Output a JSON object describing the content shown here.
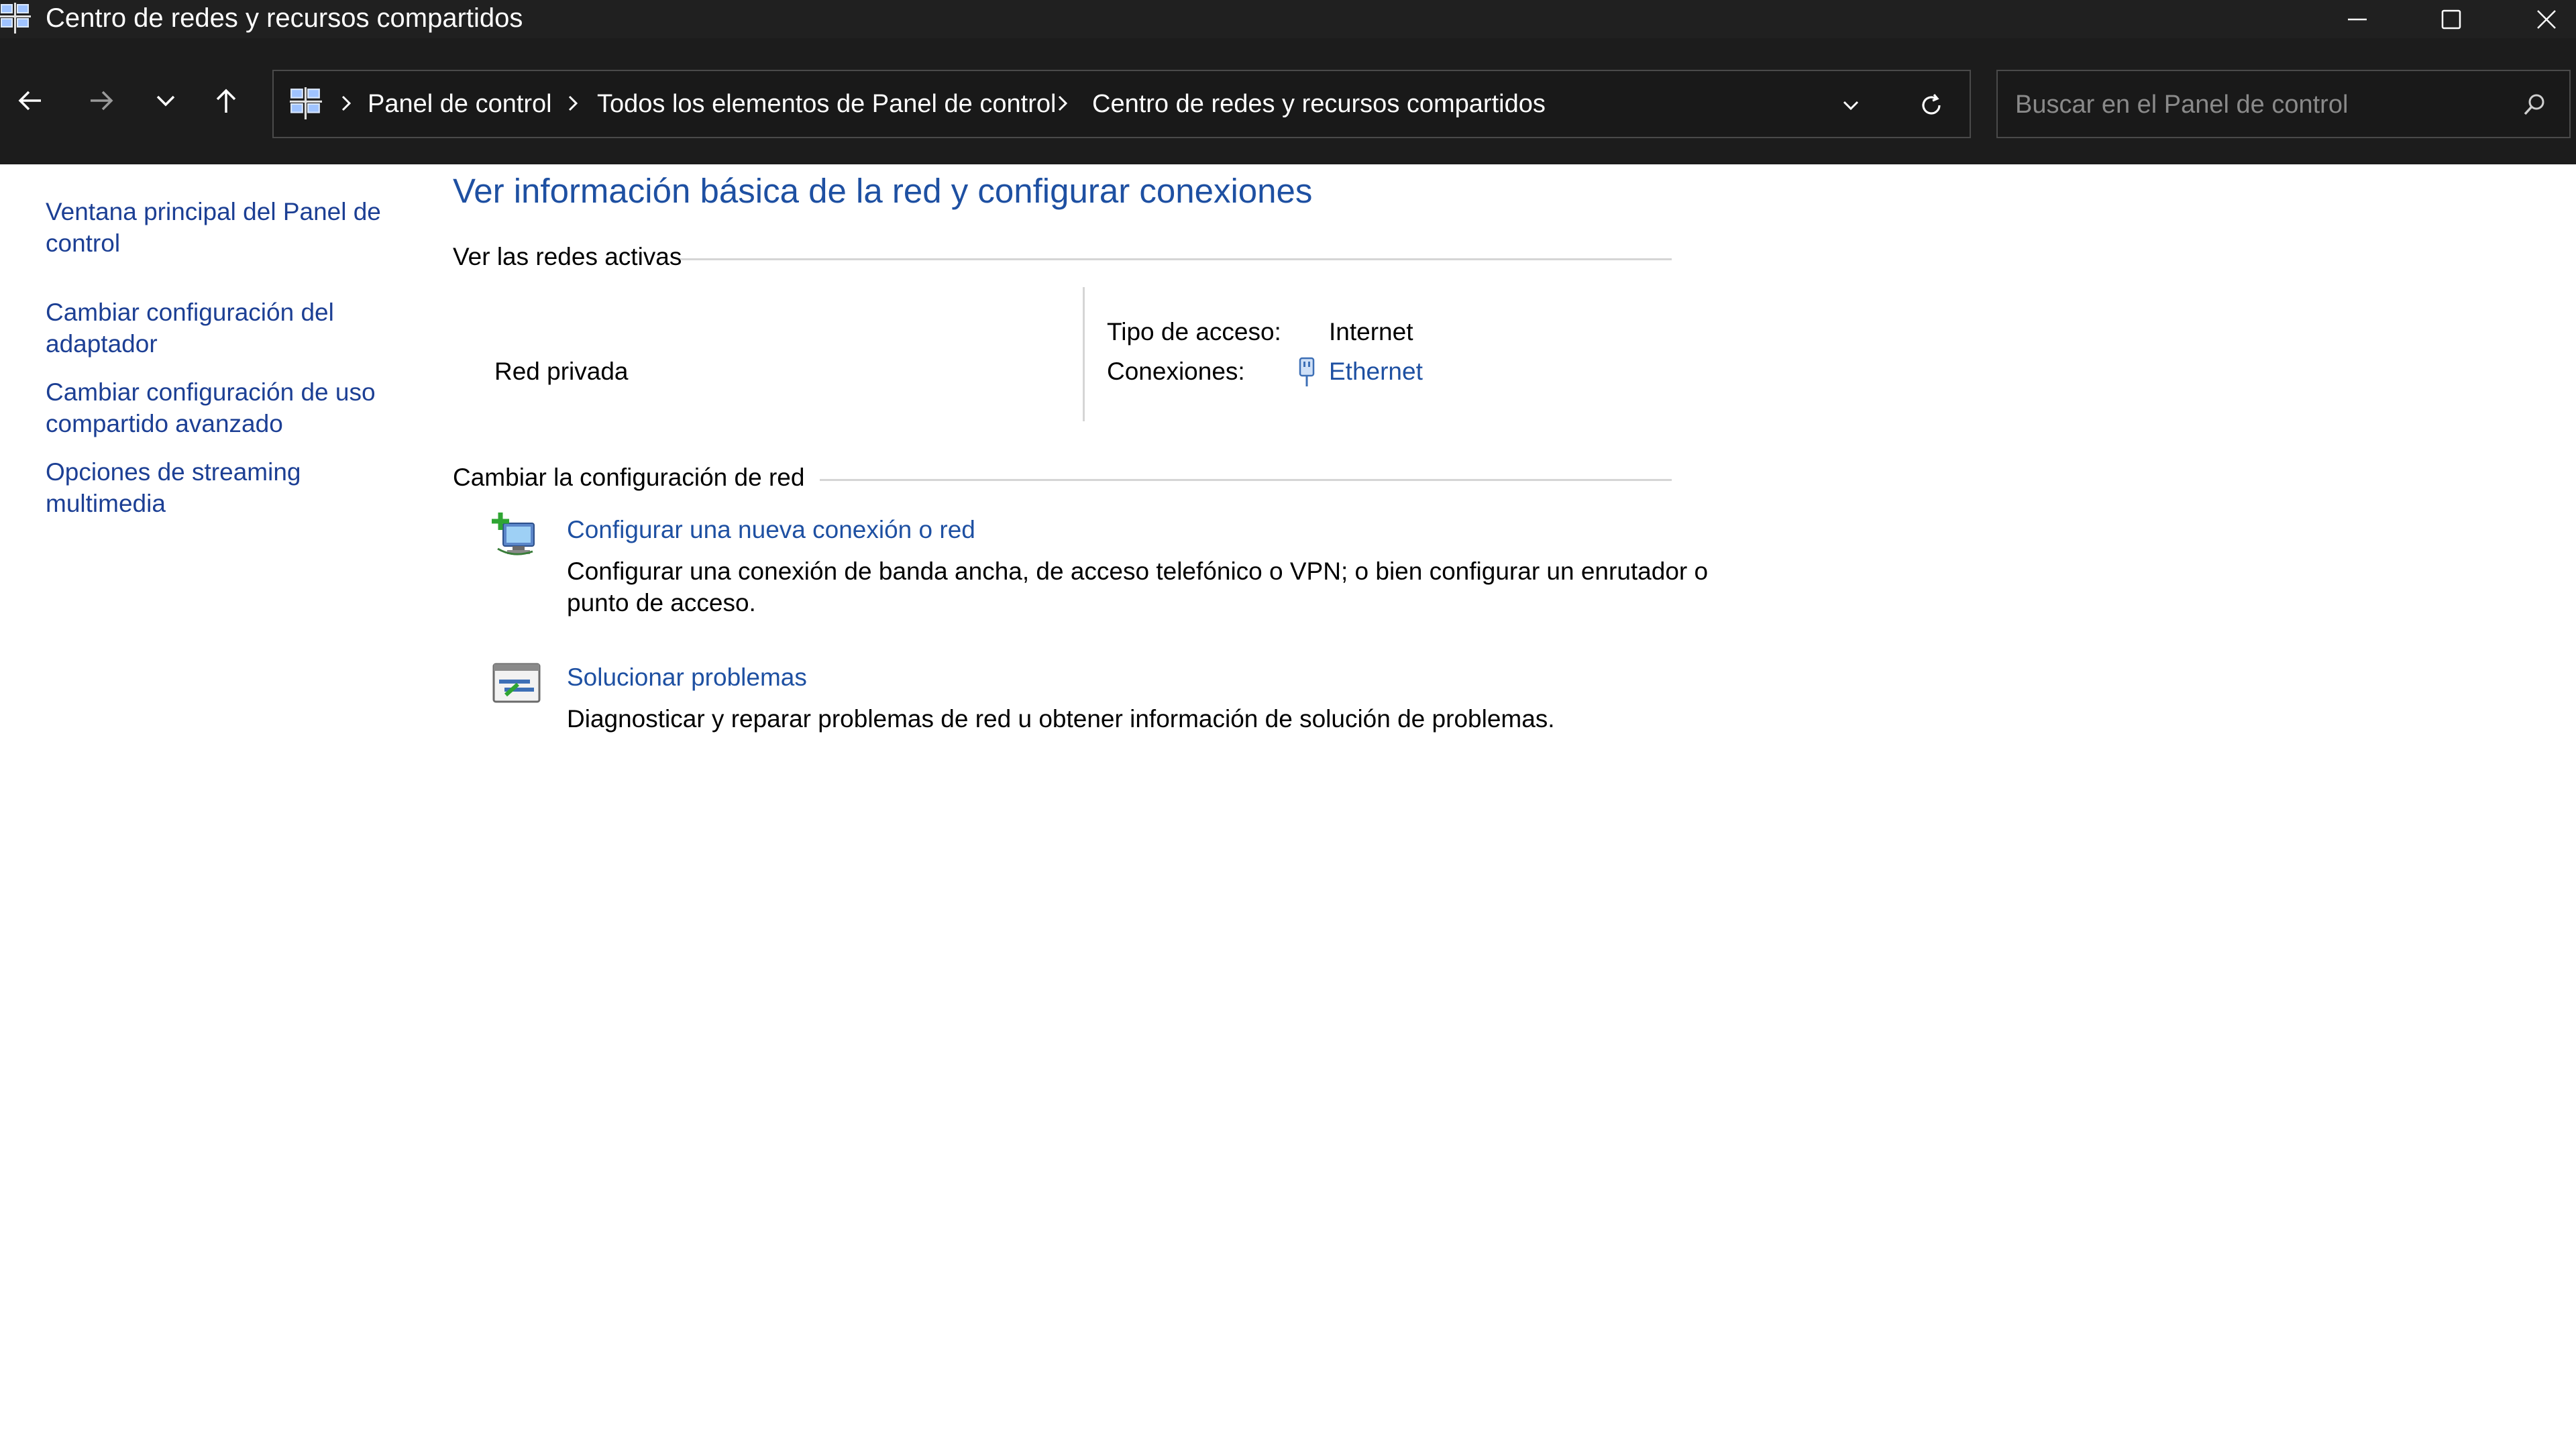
{
  "window": {
    "title": "Centro de redes y recursos compartidos",
    "app_icon": "network-center-icon",
    "buttons": {
      "minimize": "minimize-icon",
      "maximize": "maximize-icon",
      "close": "close-icon"
    }
  },
  "toolbar": {
    "back": "back-arrow-icon",
    "forward": "forward-arrow-icon",
    "recent": "chevron-down-icon",
    "up": "up-arrow-icon"
  },
  "address_bar": {
    "breadcrumbs": [
      {
        "label": "Panel de control"
      },
      {
        "label": "Todos los elementos de Panel de control"
      },
      {
        "label": "Centro de redes y recursos compartidos"
      }
    ]
  },
  "search": {
    "placeholder": "Buscar en el Panel de control",
    "value": ""
  },
  "sidebar": {
    "items": [
      {
        "label": "Ventana principal del Panel de control"
      },
      {
        "label": "Cambiar configuración del adaptador"
      },
      {
        "label": "Cambiar configuración de uso compartido avanzado"
      },
      {
        "label": "Opciones de streaming multimedia"
      }
    ]
  },
  "main": {
    "title": "Ver información básica de la red y configurar conexiones",
    "active_networks": {
      "heading": "Ver las redes activas",
      "network_name": "Red privada",
      "access_type_label": "Tipo de acceso:",
      "access_type_value": "Internet",
      "connections_label": "Conexiones:",
      "connections_value": "Ethernet"
    },
    "change_settings": {
      "heading": "Cambiar la configuración de red",
      "tasks": [
        {
          "title": "Configurar una nueva conexión o red",
          "description": "Configurar una conexión de banda ancha, de acceso telefónico o VPN; o bien configurar un enrutador o punto de acceso.",
          "icon": "new-connection-icon"
        },
        {
          "title": "Solucionar problemas",
          "description": "Diagnosticar y reparar problemas de red u obtener información de solución de problemas.",
          "icon": "troubleshoot-icon"
        }
      ]
    }
  },
  "colors": {
    "titlebar_bg": "#202020",
    "navbar_bg": "#1c1c1c",
    "link": "#1e50a2",
    "sidebar_link": "#1c3f94"
  }
}
